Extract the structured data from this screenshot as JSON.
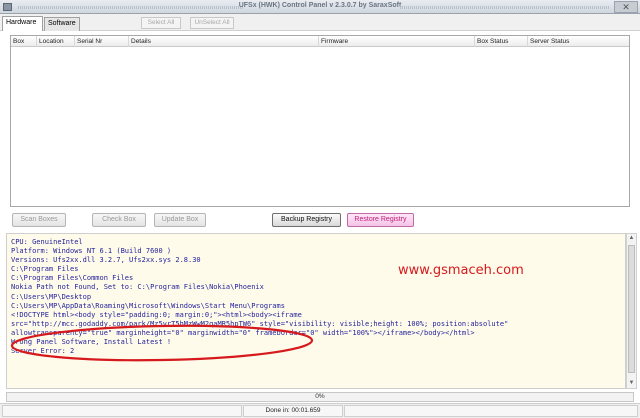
{
  "window": {
    "title": "UFSx (HWK) Control Panel v 2.3.0.7 by SaraxSoft",
    "close_glyph": "✕",
    "titlebar_icon": "app-icon"
  },
  "tabs": [
    {
      "label": "Hardware",
      "active": true
    },
    {
      "label": "Software",
      "active": false
    }
  ],
  "top_buttons": {
    "select_all": "Select All",
    "unselect_all": "UnSelect All"
  },
  "table": {
    "columns": [
      "Box",
      "Location",
      "Serial Nr",
      "Details",
      "Firmware",
      "Box Status",
      "Server Status"
    ],
    "rows": []
  },
  "actions": {
    "scan_boxes": "Scan Boxes",
    "check_box": "Check Box",
    "update_box": "Update Box",
    "backup_registry": "Backup Registry",
    "restore_registry": "Restore Registry"
  },
  "log": {
    "lines": [
      "CPU: GenuineIntel",
      "Platform: Windows NT 6.1 (Build 7600 )",
      "Versions: Ufs2xx.dll 3.2.7, Ufs2xx.sys 2.8.30",
      "C:\\Program Files",
      "C:\\Program Files\\Common Files",
      "Nokia Path not Found, Set to: C:\\Program Files\\Nokia\\Phoenix",
      "C:\\Users\\MP\\Desktop",
      "C:\\Users\\MP\\AppData\\Roaming\\Microsoft\\Windows\\Start Menu\\Programs",
      "",
      "<!DOCTYPE html><body style=\"padding:0; margin:0;\"><html><body><iframe",
      "src=\"http://mcc.godaddy.com/park/Mz5vrT5hMzWwM2qaMR5hpTW6\" style=\"visibility: visible;height: 100%; position:absolute\"",
      "allowtransparency=\"true\" marginheight=\"0\" marginwidth=\"0\" frameborder=\"0\" width=\"100%\"></iframe></body></html>",
      "Wrong Panel Software, Install Latest !",
      "Server Error: 2"
    ],
    "watermark": "www.gsmaceh.com",
    "annotation_color": "#d6191c"
  },
  "progress": {
    "value_text": "0%",
    "value": 0
  },
  "statusbar": {
    "message": "Done in: 00:01.659"
  },
  "scrollbar": {
    "up": "▲",
    "down": "▼"
  }
}
